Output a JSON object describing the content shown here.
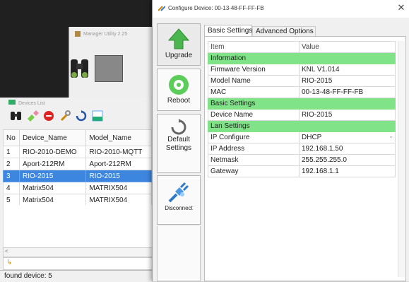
{
  "manager": {
    "title": "Manager Utility 2.25"
  },
  "devices": {
    "title": "Devices List",
    "columns": [
      "No",
      "Device_Name",
      "Model_Name"
    ],
    "rows": [
      {
        "no": "1",
        "device": "RIO-2010-DEMO",
        "model": "RIO-2010-MQTT"
      },
      {
        "no": "2",
        "device": "Aport-212RM",
        "model": "Aport-212RM"
      },
      {
        "no": "3",
        "device": "RIO-2015",
        "model": "RIO-2015"
      },
      {
        "no": "4",
        "device": "Matrix504",
        "model": "MATRIX504"
      },
      {
        "no": "5",
        "device": "Matrix504",
        "model": "MATRIX504"
      }
    ],
    "selected_row": 3,
    "status": "found device: 5"
  },
  "dialog": {
    "title": "Configure Device: 00-13-48-FF-FF-FB",
    "close": "✕",
    "buttons": {
      "upgrade": "Upgrade",
      "reboot": "Reboot",
      "default": "Default Settings",
      "disconnect": "Disconnect"
    },
    "tabs": [
      "Basic Settings",
      "Advanced Options"
    ],
    "active_tab": "Basic Settings",
    "grid": {
      "header": {
        "item": "Item",
        "value": "Value"
      },
      "rows": [
        {
          "type": "section",
          "item": "Information",
          "value": ""
        },
        {
          "type": "row",
          "item": "Firmware Version",
          "value": "KNL V1.014"
        },
        {
          "type": "row",
          "item": "Model Name",
          "value": "RIO-2015"
        },
        {
          "type": "row",
          "item": "MAC",
          "value": "00-13-48-FF-FF-FB"
        },
        {
          "type": "section",
          "item": "Basic Settings",
          "value": ""
        },
        {
          "type": "row",
          "item": "Device Name",
          "value": "RIO-2015"
        },
        {
          "type": "section",
          "item": "Lan Settings",
          "value": ""
        },
        {
          "type": "select",
          "item": "IP Configure",
          "value": "DHCP"
        },
        {
          "type": "row",
          "item": "IP Address",
          "value": "192.168.1.50"
        },
        {
          "type": "row",
          "item": "Netmask",
          "value": "255.255.255.0"
        },
        {
          "type": "row",
          "item": "Gateway",
          "value": "192.168.1.1"
        }
      ]
    }
  },
  "colors": {
    "section_green": "#80e388",
    "selection_blue": "#3d86e0",
    "dark_background": "#202020"
  }
}
